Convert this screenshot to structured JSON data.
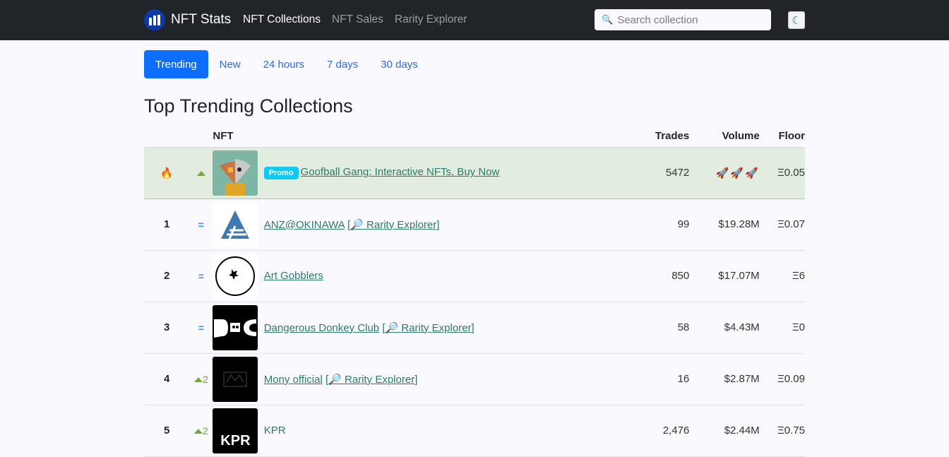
{
  "navbar": {
    "brand": "NFT Stats",
    "links": [
      {
        "label": "NFT Collections",
        "active": true
      },
      {
        "label": "NFT Sales",
        "active": false
      },
      {
        "label": "Rarity Explorer",
        "active": false
      }
    ],
    "search_placeholder": "Search collection",
    "search_icon": "🔍",
    "theme_icon": "☾"
  },
  "tabs": [
    {
      "label": "Trending",
      "active": true
    },
    {
      "label": "New",
      "active": false
    },
    {
      "label": "24 hours",
      "active": false
    },
    {
      "label": "7 days",
      "active": false
    },
    {
      "label": "30 days",
      "active": false
    }
  ],
  "page_title": "Top Trending Collections",
  "table": {
    "headers": {
      "nft": "NFT",
      "trades": "Trades",
      "volume": "Volume",
      "floor": "Floor"
    },
    "promo_row": {
      "rank_icon": "🔥",
      "badge": "Promo",
      "name": "Goofball Gang: Interactive NFTs, Buy Now",
      "trades": "5472",
      "volume": "🚀🚀🚀",
      "floor": "Ξ0.05"
    },
    "rarity_label": "Rarity Explorer",
    "rarity_icon": "🔎",
    "rows": [
      {
        "rank": "1",
        "change": "=",
        "name": "ANZ@OKINAWA",
        "rarity": true,
        "trades": "99",
        "volume": "$19.28M",
        "floor": "Ξ0.07"
      },
      {
        "rank": "2",
        "change": "=",
        "name": "Art Gobblers",
        "rarity": false,
        "trades": "850",
        "volume": "$17.07M",
        "floor": "Ξ6"
      },
      {
        "rank": "3",
        "change": "=",
        "name": "Dangerous Donkey Club",
        "rarity": true,
        "trades": "58",
        "volume": "$4.43M",
        "floor": "Ξ0"
      },
      {
        "rank": "4",
        "change": "2",
        "name": "Mony official",
        "rarity": true,
        "trades": "16",
        "volume": "$2.87M",
        "floor": "Ξ0.09"
      },
      {
        "rank": "5",
        "change": "2",
        "name": "KPR",
        "rarity": false,
        "trades": "2,476",
        "volume": "$2.44M",
        "floor": "Ξ0.75"
      }
    ]
  }
}
